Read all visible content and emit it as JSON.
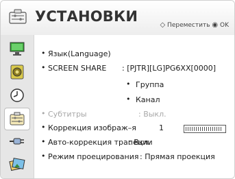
{
  "header": {
    "title": "УСТАНОВКИ",
    "hint_move_symbol": "◇",
    "hint_move": "Переместить",
    "hint_ok_symbol": "◉",
    "hint_ok": "OK",
    "icon": "settings-folder-icon"
  },
  "sidebar": {
    "items": [
      {
        "icon": "picture-icon",
        "active": false
      },
      {
        "icon": "sound-icon",
        "active": false
      },
      {
        "icon": "clock-icon",
        "active": false
      },
      {
        "icon": "settings-icon",
        "active": true
      },
      {
        "icon": "input-cable-icon",
        "active": false
      },
      {
        "icon": "media-photo-icon",
        "active": false
      }
    ]
  },
  "menu": {
    "bullet": "•",
    "language": {
      "label": "Язык(Language)"
    },
    "screen_share": {
      "label": "SCREEN SHARE",
      "value": ": [PJTR][LG]PG6XX[0000]"
    },
    "group": {
      "label": "Группа"
    },
    "channel": {
      "label": "Канал"
    },
    "subtitles": {
      "label": "Субтитры",
      "value": ": Выкл."
    },
    "image_correction": {
      "label": "Коррекция изображ–я",
      "value": "1",
      "level": 0.92
    },
    "auto_keystone": {
      "label": "Авто-коррекция трапеции",
      "value": ": Вкл."
    },
    "projection_mode": {
      "label": "Режим проецирования",
      "value": ": Прямая проекция"
    }
  },
  "colors": {
    "active_item_bg": "#ffffff",
    "sidebar_bg": "#e6e6e6",
    "disabled_text": "#a8a8a8",
    "text": "#1a1a1a"
  }
}
